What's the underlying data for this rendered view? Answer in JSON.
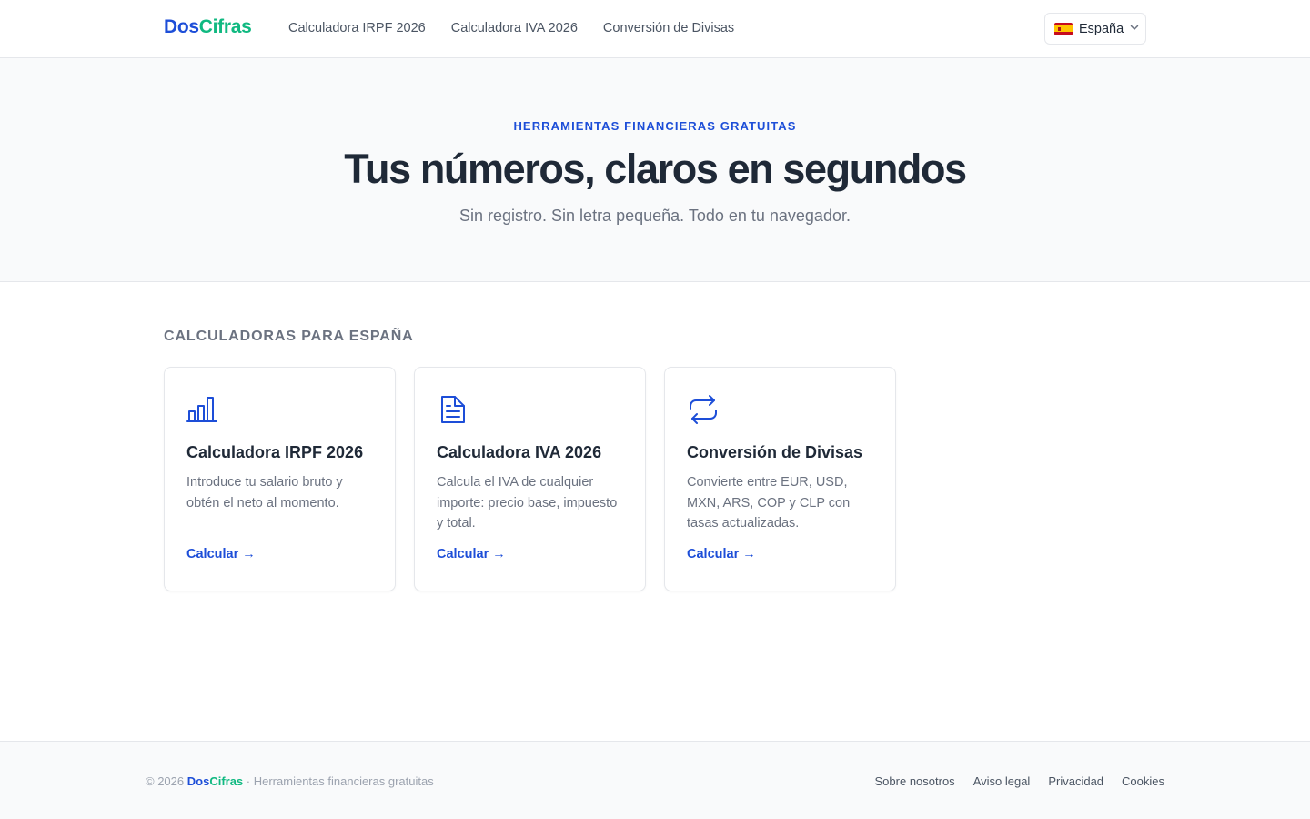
{
  "header": {
    "logo": {
      "part1": "Dos",
      "part2": "Cifras"
    },
    "nav": [
      "Calculadora IRPF 2026",
      "Calculadora IVA 2026",
      "Conversión de Divisas"
    ],
    "language": {
      "label": "España",
      "flag_icon": "spain-flag-icon"
    }
  },
  "hero": {
    "eyebrow": "HERRAMIENTAS FINANCIERAS GRATUITAS",
    "title": "Tus números, claros en segundos",
    "subtitle": "Sin registro. Sin letra pequeña. Todo en tu navegador."
  },
  "section": {
    "title": "CALCULADORAS PARA ESPAÑA",
    "cards": [
      {
        "icon": "bar-chart-icon",
        "title": "Calculadora IRPF 2026",
        "description": "Introduce tu salario bruto y obtén el neto al momento.",
        "cta": "Calcular →"
      },
      {
        "icon": "document-icon",
        "title": "Calculadora IVA 2026",
        "description": "Calcula el IVA de cualquier importe: precio base, impuesto y total.",
        "cta": "Calcular →"
      },
      {
        "icon": "exchange-arrows-icon",
        "title": "Conversión de Divisas",
        "description": "Convierte entre EUR, USD, MXN, ARS, COP y CLP con tasas actualizadas.",
        "cta": "Calcular →"
      }
    ]
  },
  "footer": {
    "copyright": "© 2026",
    "brand": {
      "part1": "Dos",
      "part2": "Cifras"
    },
    "tagline": "· Herramientas financieras gratuitas",
    "links": [
      "Sobre nosotros",
      "Aviso legal",
      "Privacidad",
      "Cookies"
    ]
  },
  "colors": {
    "accent": "#1d4ed8",
    "brand_green": "#10b981",
    "text": "#1f2937",
    "muted": "#6b7280"
  }
}
